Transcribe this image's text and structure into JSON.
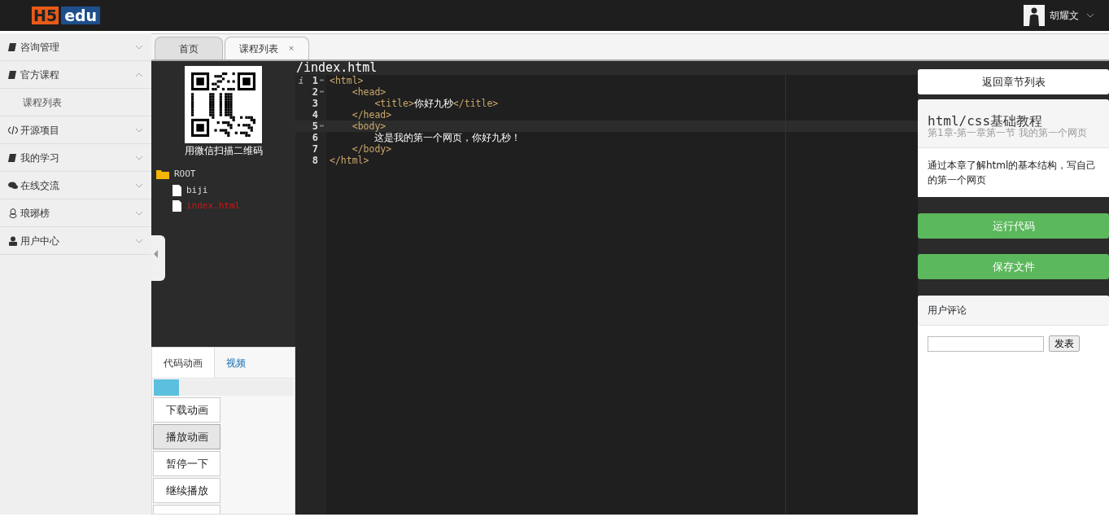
{
  "header": {
    "logo": {
      "part_1": "H5",
      "part_2": "edu"
    },
    "user": {
      "name": "胡耀文"
    }
  },
  "sidebar": {
    "items": [
      {
        "label": "咨询管理",
        "expanded": false
      },
      {
        "label": "官方课程",
        "expanded": true,
        "children": [
          {
            "label": "课程列表"
          }
        ]
      },
      {
        "label": "开源项目",
        "expanded": false
      },
      {
        "label": "我的学习",
        "expanded": false
      },
      {
        "label": "在线交流",
        "expanded": false
      },
      {
        "label": "琅琊榜",
        "expanded": false
      },
      {
        "label": "用户中心",
        "expanded": false
      }
    ]
  },
  "tabs": [
    {
      "label": "首页",
      "selected": false
    },
    {
      "label": "课程列表",
      "selected": true,
      "close": "×"
    }
  ],
  "file_panel": {
    "qr_caption": "用微信扫描二维码",
    "tree": [
      {
        "label": "ROOT",
        "kind": "folder",
        "selected": false,
        "children": [
          {
            "label": "biji",
            "kind": "file",
            "selected": false
          },
          {
            "label": "index.html",
            "kind": "file",
            "selected": true
          }
        ]
      }
    ]
  },
  "animation_panel": {
    "tabs": [
      {
        "label": "代码动画",
        "selected": true
      },
      {
        "label": "视频",
        "selected": false
      }
    ],
    "level": 0.18,
    "buttons": [
      {
        "label": "下载动画",
        "selected": false
      },
      {
        "label": "播放动画",
        "selected": true
      },
      {
        "label": "暂停一下",
        "selected": false
      },
      {
        "label": "继续播放",
        "selected": false
      }
    ]
  },
  "editor": {
    "path": "/index.html",
    "info_mark": "i",
    "lines": [
      {
        "number": "1",
        "code": "<html>",
        "fold": true,
        "current": false
      },
      {
        "number": "2",
        "code": "    <head>",
        "fold": true,
        "current": false
      },
      {
        "number": "3",
        "code": "        <title>你好九秒</title>",
        "fold": false,
        "current": false
      },
      {
        "number": "4",
        "code": "    </head>",
        "fold": false,
        "current": false
      },
      {
        "number": "5",
        "code": "    <body>",
        "fold": true,
        "current": true
      },
      {
        "number": "6",
        "code": "        这是我的第一个网页，你好九秒！",
        "fold": false,
        "current": false
      },
      {
        "number": "7",
        "code": "    </body>",
        "fold": false,
        "current": false
      },
      {
        "number": "8",
        "code": "</html>",
        "fold": false,
        "current": false
      }
    ]
  },
  "right_panel": {
    "back_button": "返回章节列表",
    "course_title": "html/css基础教程",
    "chapter": "第1章-第一章第一节 我的第一个网页",
    "description": "通过本章了解html的基本结构，写自己的第一个网页",
    "run_button": "运行代码",
    "save_button": "保存文件",
    "comments": {
      "title": "用户评论",
      "submit": "发表"
    }
  }
}
